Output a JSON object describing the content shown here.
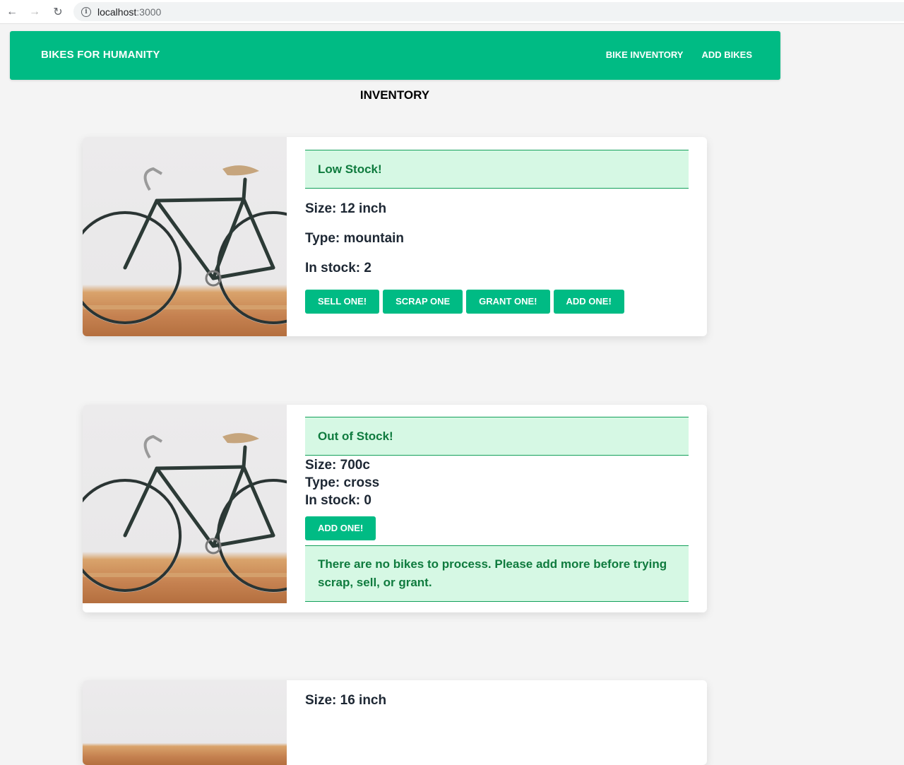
{
  "browser": {
    "url_host": "localhost",
    "url_port": ":3000"
  },
  "header": {
    "brand": "BIKES FOR HUMANITY",
    "nav": [
      "BIKE INVENTORY",
      "ADD BIKES"
    ]
  },
  "page": {
    "title": "INVENTORY"
  },
  "bikes": [
    {
      "notice": "Low Stock!",
      "size": "Size: 12 inch",
      "type": "Type: mountain",
      "stock": "In stock: 2",
      "buttons": [
        "SELL ONE!",
        "SCRAP ONE",
        "GRANT ONE!",
        "ADD ONE!"
      ]
    },
    {
      "notice": "Out of Stock!",
      "size": "Size: 700c",
      "type": "Type: cross",
      "stock": "In stock: 0",
      "buttons": [
        "ADD ONE!"
      ],
      "warning": "There are no bikes to process. Please add more before trying scrap, sell, or grant."
    },
    {
      "size": "Size: 16 inch"
    }
  ],
  "colors": {
    "accent": "#00bb84",
    "notice_bg": "#d6f8e4",
    "notice_text": "#0f7b3e",
    "background": "#f4f4f4"
  }
}
